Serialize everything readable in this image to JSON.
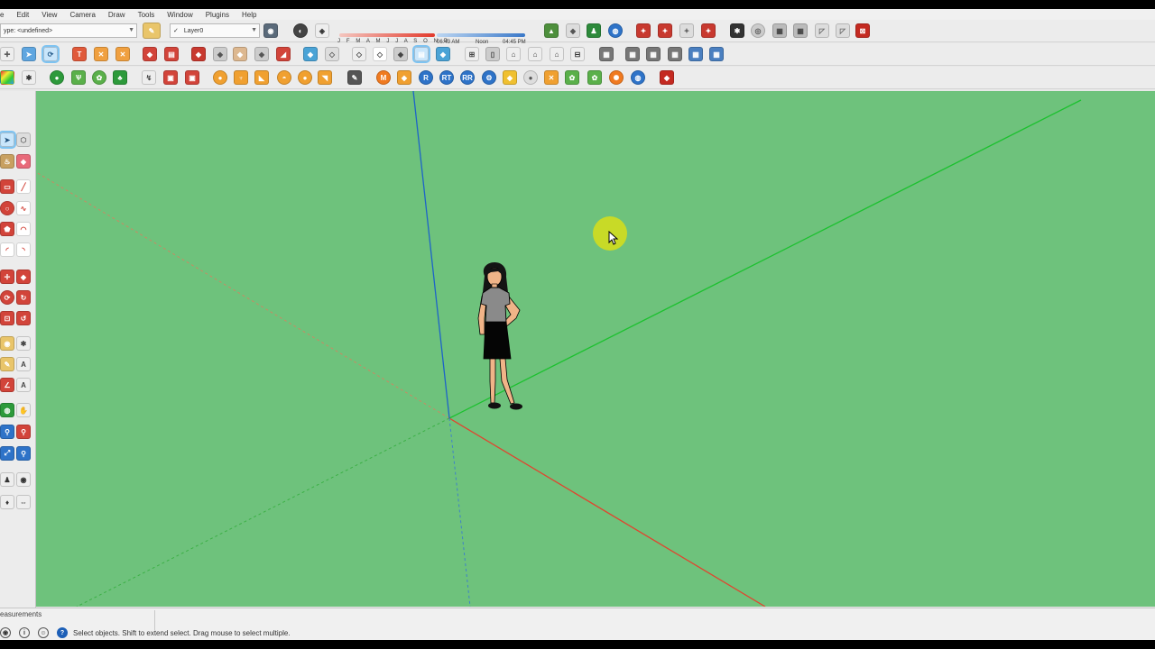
{
  "menu": [
    "e",
    "Edit",
    "View",
    "Camera",
    "Draw",
    "Tools",
    "Window",
    "Plugins",
    "Help"
  ],
  "toolbar": {
    "style_dropdown": "ype: <undefined>",
    "layer_dropdown": "Layer0",
    "layer_check": "✓"
  },
  "shadows": {
    "months": "J F M A M J J A S O N D",
    "time_start": "06:43 AM",
    "time_noon": "Noon",
    "time_end": "04:45 PM",
    "date_slider_color": "#e23a2c",
    "time_slider_color": "#3a78c8"
  },
  "statusbar": {
    "measurements_label": "easurements",
    "hint": "Select objects. Shift to extend select. Drag mouse to select multiple."
  },
  "viewport": {
    "background": "#6ec27c",
    "axes": {
      "red": "#e0452f",
      "green": "#1cc12f",
      "blue": "#1d63c8"
    }
  },
  "icons": {
    "row1": [
      "style-icon",
      "layer-manager-icon",
      "shadow-toggle-icon",
      "fog-icon",
      "geo-location-icon",
      "photo-texture-icon",
      "add-location-icon",
      "google-earth-icon",
      "3d-warehouse-icon",
      "share-model-icon",
      "extension-warehouse-icon",
      "ruby-console-icon",
      "sandbox-icon",
      "section-plane-icon"
    ],
    "row2": [
      "select-icon",
      "make-component-icon",
      "paint-bucket-icon",
      "push-pull-icon",
      "move-icon",
      "rotate-icon",
      "scale-icon",
      "offset-icon",
      "follow-me-icon",
      "intersect-icon",
      "iso-view-icon",
      "top-view-icon",
      "front-view-icon",
      "right-view-icon",
      "back-view-icon",
      "left-view-icon",
      "x-ray-icon",
      "wireframe-icon",
      "hidden-line-icon",
      "shaded-icon",
      "shaded-texture-icon",
      "monochrome-icon",
      "house-icon",
      "walls-icon"
    ],
    "row3": [
      "color-wheel-icon",
      "tree-icon",
      "grass-icon",
      "flower-icon",
      "sphere-icon",
      "lamp-icon",
      "render-icon",
      "settings-icon",
      "globe-icon"
    ]
  }
}
